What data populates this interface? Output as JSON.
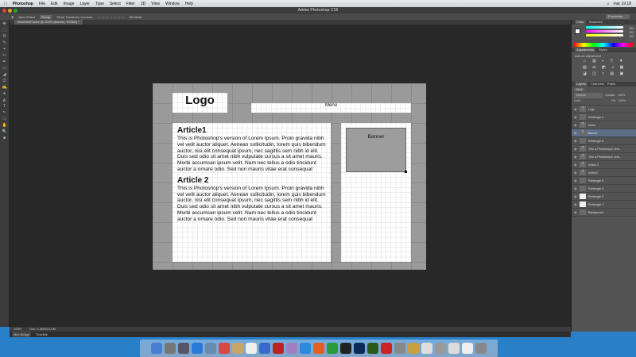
{
  "menubar": {
    "app": "Photoshop",
    "items": [
      "File",
      "Edit",
      "Image",
      "Layer",
      "Type",
      "Select",
      "Filter",
      "3D",
      "View",
      "Window",
      "Help"
    ],
    "clock": "mar 19:18"
  },
  "window": {
    "title": "Adobe Photoshop CS6"
  },
  "options": {
    "auto_select": "Auto-Select",
    "group": "Group",
    "show_transform": "Show Transform Controls",
    "mode_3d": "3D Mode",
    "workspace": "Essentials"
  },
  "document": {
    "tab": "NewWebFrame @ 100% (Banner, RGB/8) *",
    "logo": "Logo",
    "menu": "Menu",
    "banner": "Banner",
    "article1_title": "Article1",
    "article2_title": "Article 2",
    "article_body": "This is Photoshop's version  of Lorem Ipsum. Proin gravida nibh vel velit auctor aliquet. Aenean sollicitudin, lorem quis bibendum auctor, nisi elit consequat ipsum, nec sagittis sem nibh id elit. Duis sed odio sit amet nibh vulputate cursus a sit amet mauris. Morbi accumsan ipsum velit. Nam nec tellus a odio tincidunt auctor a ornare odio. Sed non  mauris vitae erat consequat"
  },
  "status": {
    "zoom": "100%",
    "doc": "Doc: 2,40M/14,0M"
  },
  "bottom_tabs": [
    "Mini Bridge",
    "Timeline"
  ],
  "panels": {
    "color_tabs": [
      "Color",
      "Swatches"
    ],
    "rgb": [
      "255",
      "255",
      "255"
    ],
    "adj_tabs": [
      "Adjustments",
      "Styles"
    ],
    "adj_title": "Add an adjustment",
    "layer_tabs": [
      "Layers",
      "Channels",
      "Paths"
    ],
    "kind": "Kind",
    "blend": "Normal",
    "opacity_label": "Opacity:",
    "opacity": "100%",
    "lock_label": "Lock:",
    "fill_label": "Fill:",
    "fill": "100%",
    "layers": [
      {
        "name": "Logo",
        "type": "T"
      },
      {
        "name": "Rectangle 2",
        "type": "shape"
      },
      {
        "name": "Menu",
        "type": "T"
      },
      {
        "name": "Banner",
        "type": "T",
        "selected": true
      },
      {
        "name": "Rectangle 6",
        "type": "shape"
      },
      {
        "name": "This is Photoshop's vers...",
        "type": "T"
      },
      {
        "name": "This is Photoshop's vers...",
        "type": "T"
      },
      {
        "name": "Article 2",
        "type": "T"
      },
      {
        "name": "Article1",
        "type": "T"
      },
      {
        "name": "Rectangle 5",
        "type": "shape"
      },
      {
        "name": "Rectangle 4",
        "type": "shape"
      },
      {
        "name": "Rectangle 3",
        "type": "white"
      },
      {
        "name": "Rectangle 1",
        "type": "white"
      },
      {
        "name": "Background",
        "type": "bg"
      }
    ]
  },
  "dock": [
    {
      "name": "Finder",
      "color": "#4a7fd0"
    },
    {
      "name": "Launchpad",
      "color": "#777"
    },
    {
      "name": "Dashboard",
      "color": "#556"
    },
    {
      "name": "App Store",
      "color": "#2a7ad8"
    },
    {
      "name": "Preview",
      "color": "#6a8ab0"
    },
    {
      "name": "Chrome",
      "color": "#d44"
    },
    {
      "name": "Notes",
      "color": "#c9a56a"
    },
    {
      "name": "Calendar",
      "color": "#eee"
    },
    {
      "name": "iTunes",
      "color": "#3a6ac8"
    },
    {
      "name": "Photo Booth",
      "color": "#b22"
    },
    {
      "name": "Orb",
      "color": "#a080c0"
    },
    {
      "name": "Word",
      "color": "#2a8ae0"
    },
    {
      "name": "PowerPoint",
      "color": "#e06020"
    },
    {
      "name": "Excel",
      "color": "#2a9a3a"
    },
    {
      "name": "Camera",
      "color": "#222"
    },
    {
      "name": "Ps",
      "color": "#0a2a5a"
    },
    {
      "name": "Dw",
      "color": "#2a5a1a"
    },
    {
      "name": "FileZilla",
      "color": "#c22"
    },
    {
      "name": "Utility",
      "color": "#888"
    },
    {
      "name": "Guitar",
      "color": "#c8a040"
    },
    {
      "name": "Disk",
      "color": "#ddd"
    },
    {
      "name": "Downloads",
      "color": "#999"
    },
    {
      "name": "Documents",
      "color": "#ddd"
    },
    {
      "name": "Files",
      "color": "#eee"
    },
    {
      "name": "Trash",
      "color": "#888"
    }
  ]
}
